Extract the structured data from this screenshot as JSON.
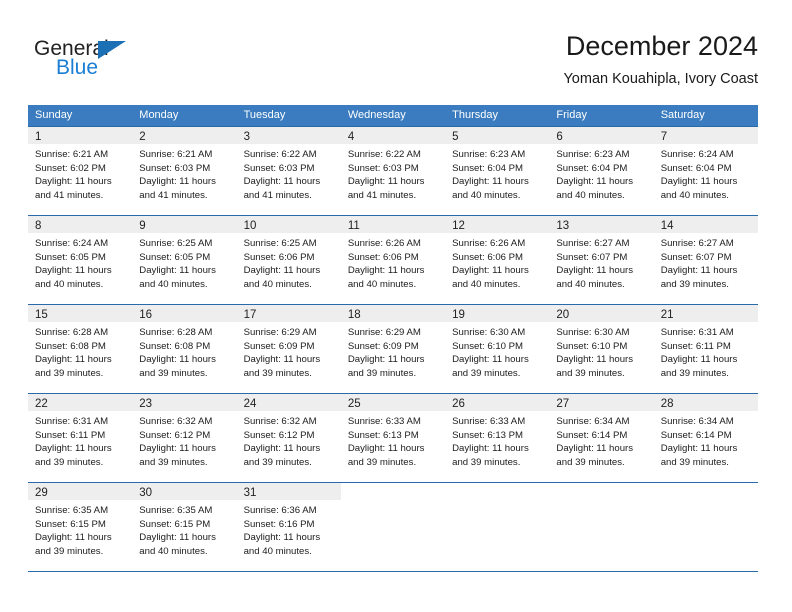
{
  "brand": {
    "name_dark": "General",
    "name_blue": "Blue",
    "triangle_color": "#1a6fb5",
    "blue_color": "#1a7fd4"
  },
  "header": {
    "title": "December 2024",
    "subtitle": "Yoman Kouahipla, Ivory Coast"
  },
  "theme": {
    "header_bg": "#3a7cbf",
    "daynum_bg": "#eeeeee",
    "rule_color": "#2b6aa8"
  },
  "weekday_headers": [
    "Sunday",
    "Monday",
    "Tuesday",
    "Wednesday",
    "Thursday",
    "Friday",
    "Saturday"
  ],
  "labels": {
    "sunrise_prefix": "Sunrise:",
    "sunset_prefix": "Sunset:",
    "daylight_prefix": "Daylight:"
  },
  "weeks": [
    [
      {
        "day": "1",
        "sunrise": "Sunrise: 6:21 AM",
        "sunset": "Sunset: 6:02 PM",
        "daylight_l1": "Daylight: 11 hours",
        "daylight_l2": "and 41 minutes."
      },
      {
        "day": "2",
        "sunrise": "Sunrise: 6:21 AM",
        "sunset": "Sunset: 6:03 PM",
        "daylight_l1": "Daylight: 11 hours",
        "daylight_l2": "and 41 minutes."
      },
      {
        "day": "3",
        "sunrise": "Sunrise: 6:22 AM",
        "sunset": "Sunset: 6:03 PM",
        "daylight_l1": "Daylight: 11 hours",
        "daylight_l2": "and 41 minutes."
      },
      {
        "day": "4",
        "sunrise": "Sunrise: 6:22 AM",
        "sunset": "Sunset: 6:03 PM",
        "daylight_l1": "Daylight: 11 hours",
        "daylight_l2": "and 41 minutes."
      },
      {
        "day": "5",
        "sunrise": "Sunrise: 6:23 AM",
        "sunset": "Sunset: 6:04 PM",
        "daylight_l1": "Daylight: 11 hours",
        "daylight_l2": "and 40 minutes."
      },
      {
        "day": "6",
        "sunrise": "Sunrise: 6:23 AM",
        "sunset": "Sunset: 6:04 PM",
        "daylight_l1": "Daylight: 11 hours",
        "daylight_l2": "and 40 minutes."
      },
      {
        "day": "7",
        "sunrise": "Sunrise: 6:24 AM",
        "sunset": "Sunset: 6:04 PM",
        "daylight_l1": "Daylight: 11 hours",
        "daylight_l2": "and 40 minutes."
      }
    ],
    [
      {
        "day": "8",
        "sunrise": "Sunrise: 6:24 AM",
        "sunset": "Sunset: 6:05 PM",
        "daylight_l1": "Daylight: 11 hours",
        "daylight_l2": "and 40 minutes."
      },
      {
        "day": "9",
        "sunrise": "Sunrise: 6:25 AM",
        "sunset": "Sunset: 6:05 PM",
        "daylight_l1": "Daylight: 11 hours",
        "daylight_l2": "and 40 minutes."
      },
      {
        "day": "10",
        "sunrise": "Sunrise: 6:25 AM",
        "sunset": "Sunset: 6:06 PM",
        "daylight_l1": "Daylight: 11 hours",
        "daylight_l2": "and 40 minutes."
      },
      {
        "day": "11",
        "sunrise": "Sunrise: 6:26 AM",
        "sunset": "Sunset: 6:06 PM",
        "daylight_l1": "Daylight: 11 hours",
        "daylight_l2": "and 40 minutes."
      },
      {
        "day": "12",
        "sunrise": "Sunrise: 6:26 AM",
        "sunset": "Sunset: 6:06 PM",
        "daylight_l1": "Daylight: 11 hours",
        "daylight_l2": "and 40 minutes."
      },
      {
        "day": "13",
        "sunrise": "Sunrise: 6:27 AM",
        "sunset": "Sunset: 6:07 PM",
        "daylight_l1": "Daylight: 11 hours",
        "daylight_l2": "and 40 minutes."
      },
      {
        "day": "14",
        "sunrise": "Sunrise: 6:27 AM",
        "sunset": "Sunset: 6:07 PM",
        "daylight_l1": "Daylight: 11 hours",
        "daylight_l2": "and 39 minutes."
      }
    ],
    [
      {
        "day": "15",
        "sunrise": "Sunrise: 6:28 AM",
        "sunset": "Sunset: 6:08 PM",
        "daylight_l1": "Daylight: 11 hours",
        "daylight_l2": "and 39 minutes."
      },
      {
        "day": "16",
        "sunrise": "Sunrise: 6:28 AM",
        "sunset": "Sunset: 6:08 PM",
        "daylight_l1": "Daylight: 11 hours",
        "daylight_l2": "and 39 minutes."
      },
      {
        "day": "17",
        "sunrise": "Sunrise: 6:29 AM",
        "sunset": "Sunset: 6:09 PM",
        "daylight_l1": "Daylight: 11 hours",
        "daylight_l2": "and 39 minutes."
      },
      {
        "day": "18",
        "sunrise": "Sunrise: 6:29 AM",
        "sunset": "Sunset: 6:09 PM",
        "daylight_l1": "Daylight: 11 hours",
        "daylight_l2": "and 39 minutes."
      },
      {
        "day": "19",
        "sunrise": "Sunrise: 6:30 AM",
        "sunset": "Sunset: 6:10 PM",
        "daylight_l1": "Daylight: 11 hours",
        "daylight_l2": "and 39 minutes."
      },
      {
        "day": "20",
        "sunrise": "Sunrise: 6:30 AM",
        "sunset": "Sunset: 6:10 PM",
        "daylight_l1": "Daylight: 11 hours",
        "daylight_l2": "and 39 minutes."
      },
      {
        "day": "21",
        "sunrise": "Sunrise: 6:31 AM",
        "sunset": "Sunset: 6:11 PM",
        "daylight_l1": "Daylight: 11 hours",
        "daylight_l2": "and 39 minutes."
      }
    ],
    [
      {
        "day": "22",
        "sunrise": "Sunrise: 6:31 AM",
        "sunset": "Sunset: 6:11 PM",
        "daylight_l1": "Daylight: 11 hours",
        "daylight_l2": "and 39 minutes."
      },
      {
        "day": "23",
        "sunrise": "Sunrise: 6:32 AM",
        "sunset": "Sunset: 6:12 PM",
        "daylight_l1": "Daylight: 11 hours",
        "daylight_l2": "and 39 minutes."
      },
      {
        "day": "24",
        "sunrise": "Sunrise: 6:32 AM",
        "sunset": "Sunset: 6:12 PM",
        "daylight_l1": "Daylight: 11 hours",
        "daylight_l2": "and 39 minutes."
      },
      {
        "day": "25",
        "sunrise": "Sunrise: 6:33 AM",
        "sunset": "Sunset: 6:13 PM",
        "daylight_l1": "Daylight: 11 hours",
        "daylight_l2": "and 39 minutes."
      },
      {
        "day": "26",
        "sunrise": "Sunrise: 6:33 AM",
        "sunset": "Sunset: 6:13 PM",
        "daylight_l1": "Daylight: 11 hours",
        "daylight_l2": "and 39 minutes."
      },
      {
        "day": "27",
        "sunrise": "Sunrise: 6:34 AM",
        "sunset": "Sunset: 6:14 PM",
        "daylight_l1": "Daylight: 11 hours",
        "daylight_l2": "and 39 minutes."
      },
      {
        "day": "28",
        "sunrise": "Sunrise: 6:34 AM",
        "sunset": "Sunset: 6:14 PM",
        "daylight_l1": "Daylight: 11 hours",
        "daylight_l2": "and 39 minutes."
      }
    ],
    [
      {
        "day": "29",
        "sunrise": "Sunrise: 6:35 AM",
        "sunset": "Sunset: 6:15 PM",
        "daylight_l1": "Daylight: 11 hours",
        "daylight_l2": "and 39 minutes."
      },
      {
        "day": "30",
        "sunrise": "Sunrise: 6:35 AM",
        "sunset": "Sunset: 6:15 PM",
        "daylight_l1": "Daylight: 11 hours",
        "daylight_l2": "and 40 minutes."
      },
      {
        "day": "31",
        "sunrise": "Sunrise: 6:36 AM",
        "sunset": "Sunset: 6:16 PM",
        "daylight_l1": "Daylight: 11 hours",
        "daylight_l2": "and 40 minutes."
      },
      {
        "day": "",
        "sunrise": "",
        "sunset": "",
        "daylight_l1": "",
        "daylight_l2": ""
      },
      {
        "day": "",
        "sunrise": "",
        "sunset": "",
        "daylight_l1": "",
        "daylight_l2": ""
      },
      {
        "day": "",
        "sunrise": "",
        "sunset": "",
        "daylight_l1": "",
        "daylight_l2": ""
      },
      {
        "day": "",
        "sunrise": "",
        "sunset": "",
        "daylight_l1": "",
        "daylight_l2": ""
      }
    ]
  ]
}
